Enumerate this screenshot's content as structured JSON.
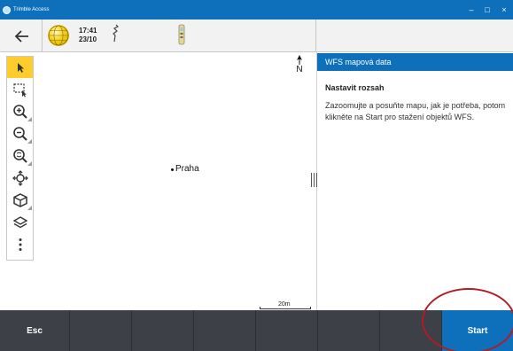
{
  "window": {
    "app_name": "Trimble Access",
    "minimize": "–",
    "maximize": "□",
    "close": "×"
  },
  "toolbar": {
    "back_icon": "arrow-left-icon",
    "time": "17:41",
    "date": "23/10"
  },
  "map_tools": [
    {
      "icon": "select-arrow-icon",
      "active": true
    },
    {
      "icon": "box-select-icon",
      "active": false
    },
    {
      "icon": "zoom-in-icon",
      "active": false
    },
    {
      "icon": "zoom-out-icon",
      "active": false
    },
    {
      "icon": "zoom-extents-icon",
      "active": false
    },
    {
      "icon": "pan-icon",
      "active": false
    },
    {
      "icon": "3d-view-icon",
      "active": false
    },
    {
      "icon": "layers-icon",
      "active": false
    },
    {
      "icon": "more-icon",
      "active": false
    }
  ],
  "map": {
    "north_label": "N",
    "place_label": "Praha",
    "scale_label": "20m"
  },
  "panel": {
    "title": "WFS mapová data",
    "subtitle": "Nastavit rozsah",
    "instructions": "Zazoomujte a posuňte mapu, jak je potřeba, potom klikněte na Start pro stažení objektů WFS."
  },
  "bottom_bar": {
    "esc_label": "Esc",
    "start_label": "Start"
  },
  "colors": {
    "accent": "#0e6fba",
    "active_tool": "#ffcc2e",
    "bottom_bar": "#3d4046",
    "highlight_ring": "#b01d22"
  }
}
